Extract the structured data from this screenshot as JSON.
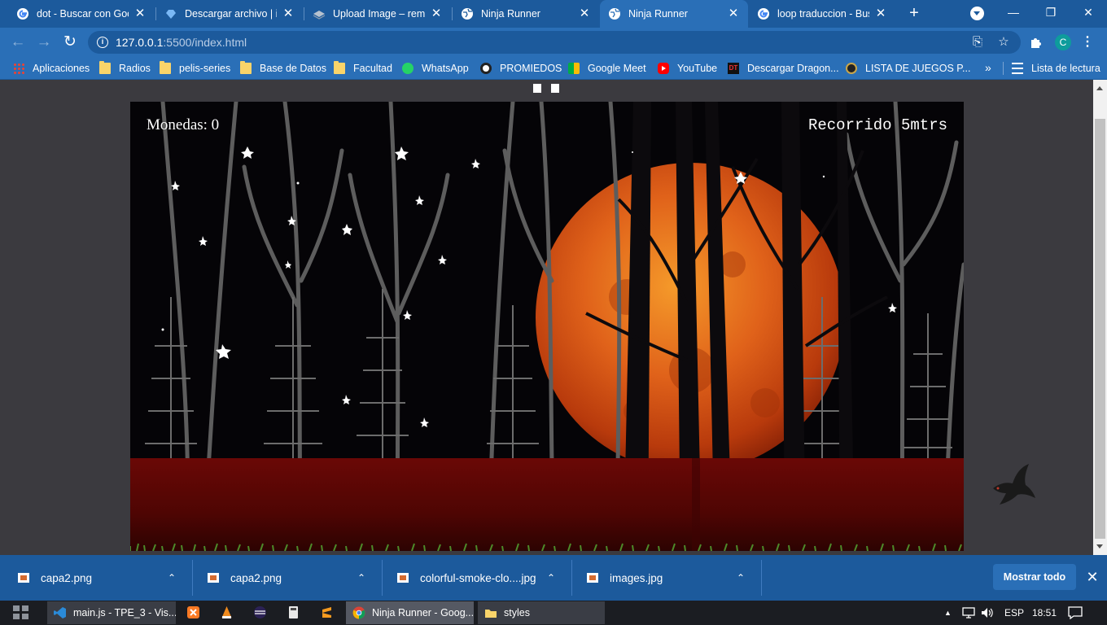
{
  "browser": {
    "tabs": [
      {
        "title": "dot - Buscar con Google",
        "favicon": "google-icon",
        "active": false
      },
      {
        "title": "Descargar archivo | iLovePDF",
        "favicon": "ilovepdf-icon",
        "active": false
      },
      {
        "title": "Upload Image – remove.bg",
        "favicon": "removebg-icon",
        "active": false
      },
      {
        "title": "Ninja Runner",
        "favicon": "globe-icon",
        "active": false
      },
      {
        "title": "Ninja Runner",
        "favicon": "globe-icon",
        "active": true
      },
      {
        "title": "loop traduccion - Buscar con Google",
        "favicon": "google-icon",
        "active": false
      }
    ],
    "new_tab_label": "+",
    "window": {
      "minimize": "—",
      "restore": "❐",
      "close": "✕"
    },
    "address": {
      "host": "127.0.0.1",
      "rest": ":5500/index.html"
    },
    "profile_initial": "C",
    "bookmarks": [
      {
        "label": "Aplicaciones",
        "icon": "apps-grid-icon"
      },
      {
        "label": "Radios",
        "icon": "folder-icon"
      },
      {
        "label": "pelis-series",
        "icon": "folder-icon"
      },
      {
        "label": "Base de Datos",
        "icon": "folder-icon"
      },
      {
        "label": "Facultad",
        "icon": "folder-icon"
      },
      {
        "label": "WhatsApp",
        "icon": "whatsapp-icon"
      },
      {
        "label": "PROMIEDOS",
        "icon": "soccer-ball-icon"
      },
      {
        "label": "Google Meet",
        "icon": "google-meet-icon"
      },
      {
        "label": "YouTube",
        "icon": "youtube-icon"
      },
      {
        "label": "Descargar Dragon...",
        "icon": "dt-icon"
      },
      {
        "label": "LISTA DE JUEGOS P...",
        "icon": "lista-juegos-icon"
      }
    ],
    "bookmarks_more": "»",
    "reading_list": "Lista de lectura"
  },
  "game": {
    "coins_label": "Monedas: 0",
    "distance_label": "Recorrido 5mtrs",
    "colors": {
      "sky": "#050407",
      "moon": "#e05a12",
      "ground": "#5a0604",
      "grass": "#3f7a22",
      "trees": "#6c6c6c"
    }
  },
  "downloads": {
    "items": [
      {
        "name": "capa2.png"
      },
      {
        "name": "capa2.png"
      },
      {
        "name": "colorful-smoke-clo....jpg"
      },
      {
        "name": "images.jpg"
      }
    ],
    "show_all": "Mostrar todo",
    "close": "✕"
  },
  "taskbar": {
    "apps": [
      {
        "label": "main.js - TPE_3 - Vis...",
        "icon": "vscode-icon",
        "active": false
      },
      {
        "label": "Ninja Runner - Goog...",
        "icon": "chrome-icon",
        "active": true
      },
      {
        "label": "styles",
        "icon": "folder-icon",
        "active": false
      }
    ],
    "language": "ESP",
    "clock": "18:51"
  }
}
